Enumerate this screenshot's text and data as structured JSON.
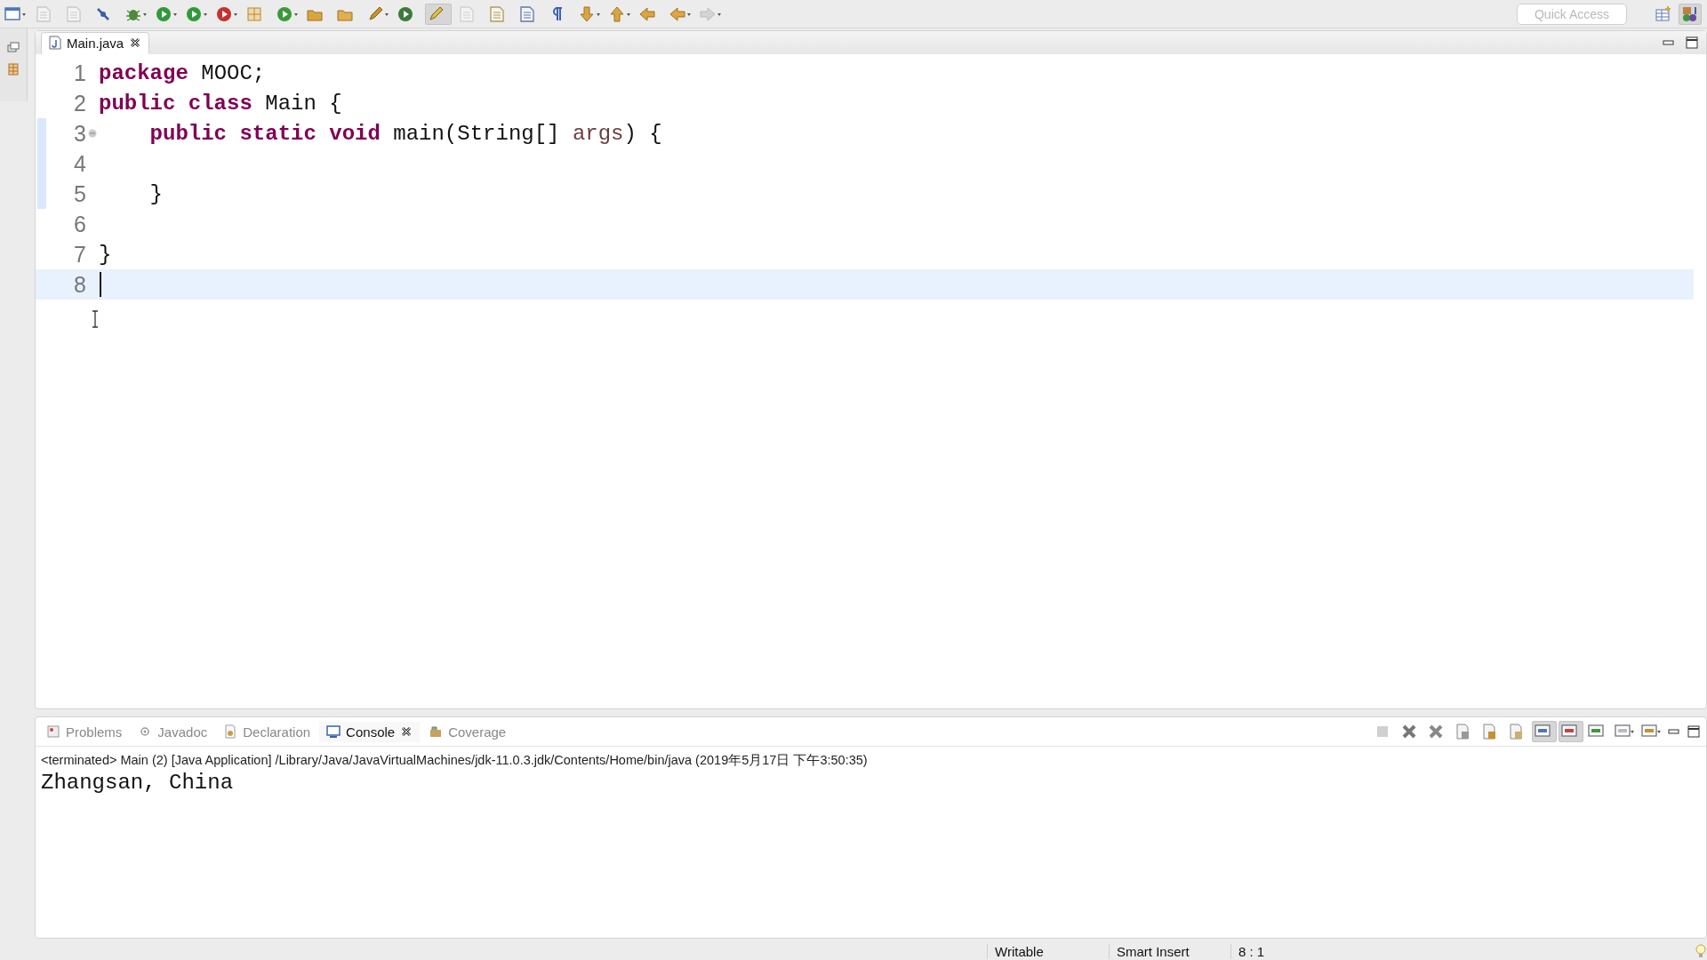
{
  "toolbar": {
    "quick_access": {
      "placeholder": "Quick Access"
    }
  },
  "editor": {
    "tabs": [
      {
        "label": "Main.java",
        "selected": true
      }
    ],
    "lines": [
      {
        "number": "1",
        "current": false,
        "changed": false,
        "foldable": false,
        "tokens": [
          {
            "text": "package",
            "kind": "keyword"
          },
          {
            "text": " MOOC;",
            "kind": "plain"
          }
        ]
      },
      {
        "number": "2",
        "current": false,
        "changed": false,
        "foldable": false,
        "tokens": [
          {
            "text": "public class",
            "kind": "keyword"
          },
          {
            "text": " Main {",
            "kind": "plain"
          }
        ]
      },
      {
        "number": "3",
        "current": false,
        "changed": true,
        "foldable": true,
        "tokens": [
          {
            "text": "    public static void",
            "kind": "keyword"
          },
          {
            "text": " main(String[] ",
            "kind": "plain"
          },
          {
            "text": "args",
            "kind": "param"
          },
          {
            "text": ") {",
            "kind": "plain"
          }
        ]
      },
      {
        "number": "4",
        "current": false,
        "changed": true,
        "foldable": false
      },
      {
        "number": "5",
        "current": false,
        "changed": true,
        "foldable": false,
        "tokens": [
          {
            "text": "    }",
            "kind": "plain"
          }
        ]
      },
      {
        "number": "6",
        "current": false,
        "changed": false,
        "foldable": false
      },
      {
        "number": "7",
        "current": false,
        "changed": false,
        "foldable": false,
        "tokens": [
          {
            "text": "}",
            "kind": "plain"
          }
        ]
      },
      {
        "number": "8",
        "current": true,
        "changed": false,
        "foldable": false
      }
    ]
  },
  "console_view": {
    "tabs": [
      {
        "label": "Problems",
        "selected": false
      },
      {
        "label": "Javadoc",
        "selected": false
      },
      {
        "label": "Declaration",
        "selected": false
      },
      {
        "label": "Console",
        "selected": true
      },
      {
        "label": "Coverage",
        "selected": false
      }
    ],
    "header": "<terminated> Main (2) [Java Application] /Library/Java/JavaVirtualMachines/jdk-11.0.3.jdk/Contents/Home/bin/java (2019年5月17日 下午3:50:35)",
    "output": "Zhangsan, China"
  },
  "status_bar": {
    "items": [
      "Writable",
      "Smart Insert",
      "8 : 1"
    ]
  }
}
